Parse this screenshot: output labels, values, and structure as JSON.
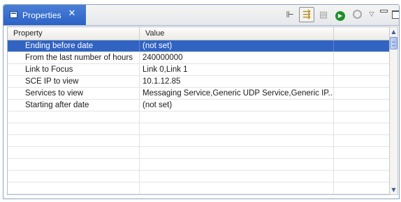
{
  "view": {
    "tab_label": "Properties",
    "tab_icon": "properties-view-icon",
    "close_glyph": "✕",
    "toolbar": [
      {
        "name": "show-categories-icon",
        "glyph": "⊩"
      },
      {
        "name": "filter-advanced-icon",
        "glyph": "⇶",
        "pressed": true
      },
      {
        "name": "restore-default-icon",
        "glyph": "▤"
      },
      {
        "name": "run-icon",
        "glyph": "▶"
      },
      {
        "name": "refresh-icon",
        "glyph": ""
      },
      {
        "name": "view-menu-icon",
        "glyph": "▽"
      },
      {
        "name": "minimize-icon",
        "glyph": ""
      },
      {
        "name": "maximize-icon",
        "glyph": ""
      }
    ]
  },
  "table": {
    "columns": [
      "Property",
      "Value",
      ""
    ],
    "rows": [
      {
        "property": "Ending before date",
        "value": "(not set)",
        "selected": true
      },
      {
        "property": "From the last number of hours",
        "value": "240000000"
      },
      {
        "property": "Link to Focus",
        "value": "Link 0,Link 1"
      },
      {
        "property": "SCE IP to view",
        "value": "10.1.12.85"
      },
      {
        "property": "Services to view",
        "value": "Messaging Service,Generic UDP Service,Generic IP..."
      },
      {
        "property": "Starting after date",
        "value": "(not set)"
      }
    ]
  },
  "colors": {
    "tab_active": "#2b63c6",
    "selection": "#3163c3",
    "border": "#8ea3c1"
  }
}
